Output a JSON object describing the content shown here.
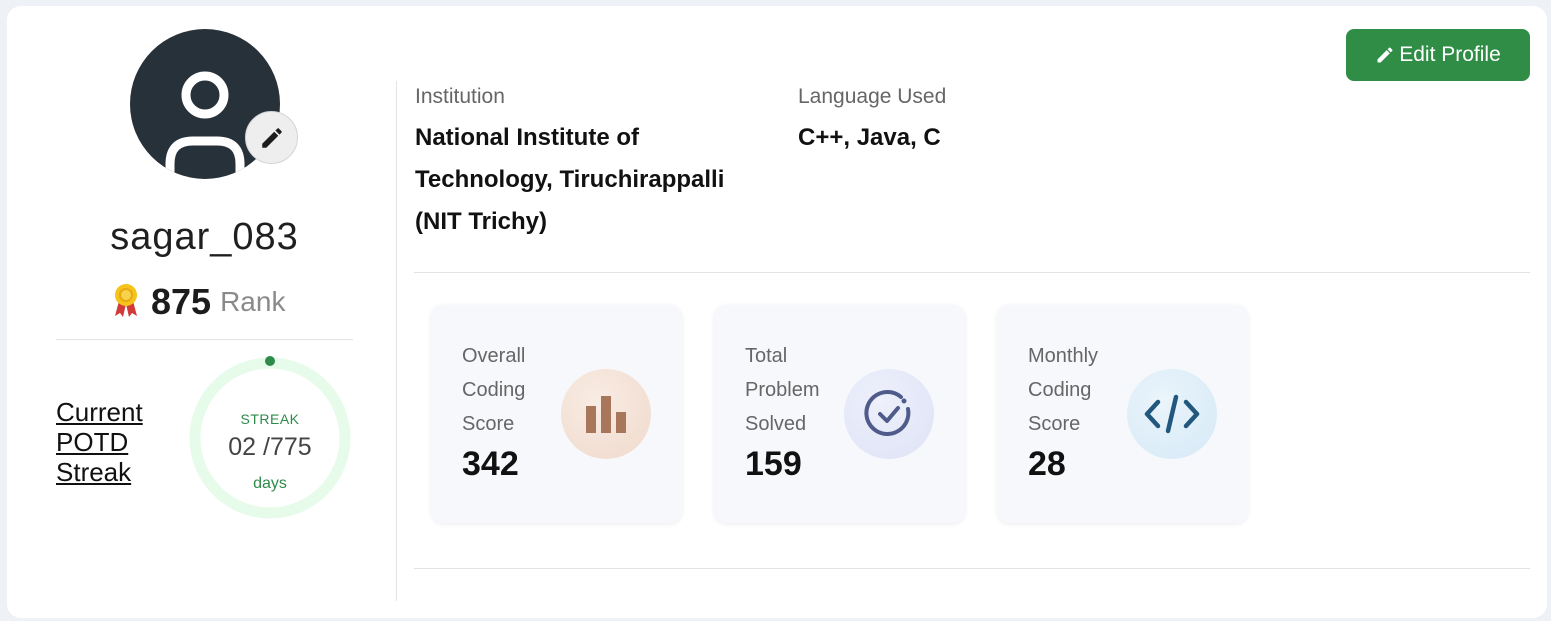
{
  "profile": {
    "username": "sagar_083",
    "rank_value": "875",
    "rank_label": "Rank",
    "icons": {
      "avatar": "user-icon",
      "avatar_edit": "pencil-icon",
      "medal": "medal-icon"
    }
  },
  "streak": {
    "link_text": "Current POTD Streak",
    "label": "STREAK",
    "value": "02 /775",
    "unit": "days",
    "accent": "#2e8b4a",
    "ring_color": "#e6fbe9"
  },
  "edit_profile": {
    "label": "Edit Profile",
    "color": "#2f8d46",
    "icon": "pencil-icon"
  },
  "info": {
    "institution_label": "Institution",
    "institution_line1": "National Institute of",
    "institution_line2": "Technology, Tiruchirappalli",
    "institution_line3": "(NIT Trichy)",
    "language_label": "Language Used",
    "language_value": "C++, Java, C"
  },
  "stats": [
    {
      "label": "Overall Coding Score",
      "value": "342",
      "icon": "bar-chart-icon",
      "icon_color": "#a8765a"
    },
    {
      "label": "Total Problem Solved",
      "value": "159",
      "icon": "check-circle-icon",
      "icon_color": "#4f5b8a"
    },
    {
      "label": "Monthly Coding Score",
      "value": "28",
      "icon": "code-icon",
      "icon_color": "#22577e"
    }
  ]
}
